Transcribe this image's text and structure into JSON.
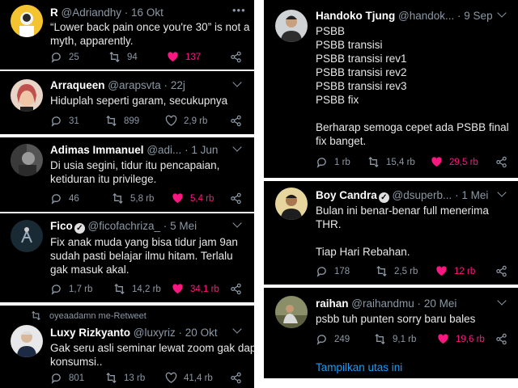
{
  "tweets": [
    {
      "name": "R",
      "handle": "@Adriandhy",
      "sep": "·",
      "time": "16 Okt",
      "verified": false,
      "menu": "dots",
      "lines": [
        "“Lower back pain once you're 30” is not a",
        "myth, apparently."
      ],
      "replies": "25",
      "retweets": "94",
      "likes": "137",
      "liked": true
    },
    {
      "name": "Arraqueen",
      "handle": "@arapsvta",
      "sep": "·",
      "time": "22j",
      "verified": false,
      "menu": "chevron",
      "lines": [
        "Hiduplah seperti garam, secukupnya"
      ],
      "replies": "31",
      "retweets": "899",
      "likes": "2,9 rb",
      "liked": false
    },
    {
      "name": "Adimas Immanuel",
      "handle": "@adi...",
      "sep": "·",
      "time": "1 Jun",
      "verified": false,
      "menu": "chevron",
      "lines": [
        "Di usia segini, tidur itu pencapaian,",
        "ketiduran itu privilege."
      ],
      "replies": "46",
      "retweets": "5,8 rb",
      "likes": "5,4 rb",
      "liked": true
    },
    {
      "name": "Fico",
      "handle": "@ficofachriza_",
      "sep": "·",
      "time": "5 Mei",
      "verified": true,
      "menu": "chevron",
      "lines": [
        "Fix anak muda yang bisa tidur jam 9an",
        "sudah pasti belajar ilmu hitam. Terlalu",
        "gak masuk akal."
      ],
      "replies": "1,7 rb",
      "retweets": "14,2 rb",
      "likes": "34,1 rb",
      "liked": true
    },
    {
      "context": "oyeaadamn me-Retweet",
      "name": "Luxy Rizkyanto",
      "handle": "@luxyriz",
      "sep": "·",
      "time": "20 Okt",
      "verified": false,
      "menu": "chevron",
      "lines": [
        "Gak seru asli seminar lewat zoom gak dapet",
        "konsumsi.."
      ],
      "replies": "801",
      "retweets": "13 rb",
      "likes": "41,4 rb",
      "liked": false
    },
    {
      "name": "Handoko Tjung",
      "handle": "@handok...",
      "sep": "·",
      "time": "9 Sep",
      "verified": false,
      "menu": "chevron",
      "lines": [
        "PSBB",
        "PSBB transisi",
        "PSBB transisi rev1",
        "PSBB transisi rev2",
        "PSBB transisi rev3",
        "PSBB fix",
        "",
        "Berharap semoga cepet ada PSBB final",
        "fix banget."
      ],
      "replies": "1 rb",
      "retweets": "15,4 rb",
      "likes": "29,5 rb",
      "liked": true
    },
    {
      "name": "Boy Candra",
      "handle": "@dsuperb...",
      "sep": "·",
      "time": "1 Mei",
      "verified": true,
      "menu": "chevron",
      "lines": [
        "Bulan ini benar-benar full menerima",
        "THR.",
        "",
        "Tiap Hari Rebahan."
      ],
      "replies": "178",
      "retweets": "2,5 rb",
      "likes": "12 rb",
      "liked": true
    },
    {
      "name": "raihan",
      "handle": "@raihandmu",
      "sep": "·",
      "time": "20 Mei",
      "verified": false,
      "menu": "chevron",
      "lines": [
        "psbb tuh punten sorry baru bales"
      ],
      "replies": "249",
      "retweets": "9,1 rb",
      "likes": "19,6 rb",
      "liked": true,
      "thread_link": "Tampilkan utas ini"
    }
  ],
  "colors": {
    "like": "#f91880",
    "muted": "#8b98a5",
    "link": "#1d9bf0",
    "card": "#000000"
  },
  "icons": [
    "reply-icon",
    "retweet-icon",
    "heart-icon",
    "share-icon",
    "verified-badge-icon",
    "more-dots-icon",
    "chevron-down-icon"
  ]
}
